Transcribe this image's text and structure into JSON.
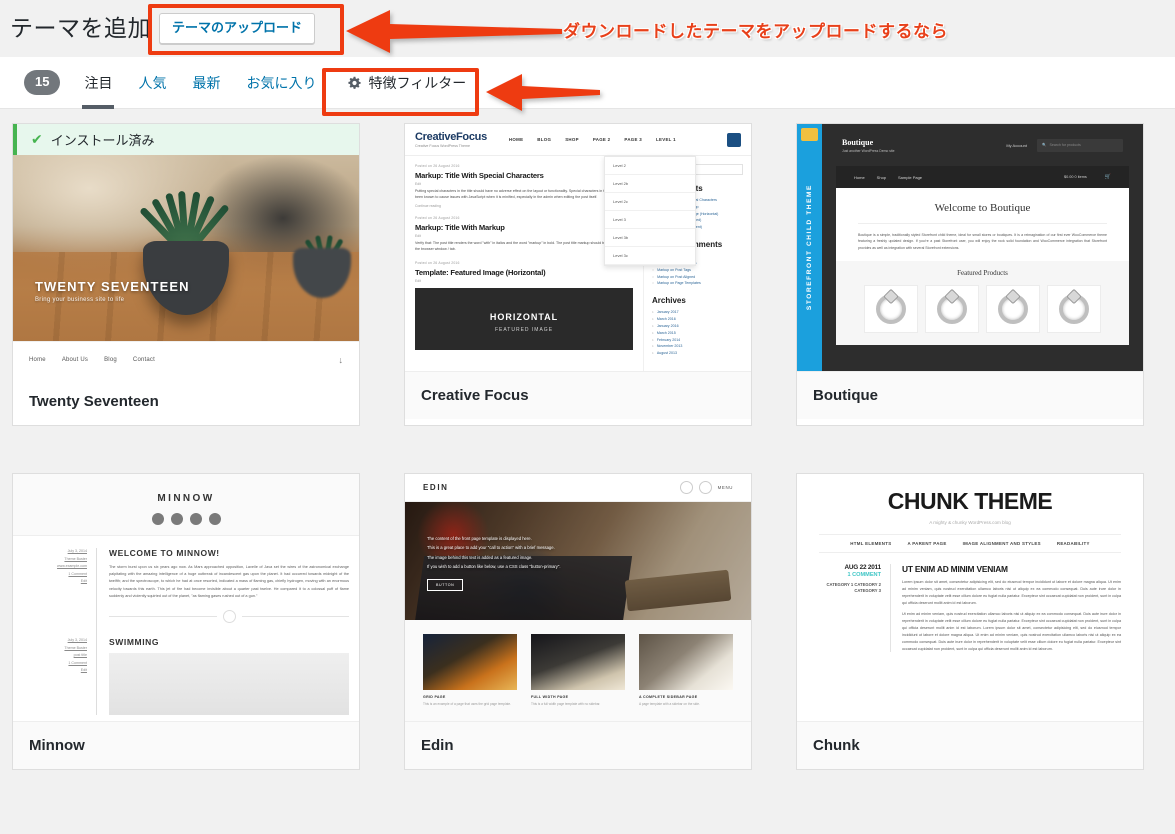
{
  "header": {
    "title": "テーマを追加",
    "upload_button": "テーマのアップロード"
  },
  "tabs": {
    "count_badge": "15",
    "items": [
      {
        "label": "注目",
        "active": true
      },
      {
        "label": "人気",
        "active": false
      },
      {
        "label": "最新",
        "active": false
      },
      {
        "label": "お気に入り",
        "active": false
      }
    ],
    "filter_label": "特徴フィルター",
    "filter_icon": "gear-icon"
  },
  "annotations": {
    "upload_note": "ダウンロードしたテーマをアップロードするなら",
    "accent_color": "#ee3b11"
  },
  "themes": [
    {
      "name": "Twenty Seventeen",
      "installed": true,
      "installed_label": "インストール済み",
      "preview": {
        "hero_title": "TWENTY SEVENTEEN",
        "hero_subtitle": "Bring your business site to life",
        "nav": [
          "Home",
          "About Us",
          "Blog",
          "Contact"
        ],
        "scroll_icon": "↓"
      }
    },
    {
      "name": "Creative Focus",
      "installed": false,
      "preview": {
        "logo": "CreativeFocus",
        "logo_tagline": "Creative Focus WordPress Theme",
        "menu": [
          "HOME",
          "BLOG",
          "SHOP",
          "PAGE 2",
          "PAGE 3",
          "LEVEL 1"
        ],
        "dropdown": [
          "Level 2",
          "Level 2b",
          "Level 2c",
          "Level 3",
          "Level 3b",
          "Level 3c"
        ],
        "posts": [
          {
            "meta": "Posted on 26 August 2016",
            "title": "Markup: Title With Special Characters",
            "sub": "Edit",
            "body": "Putting special characters in the title should have no adverse effect on the layout or functionality. Special characters in the post title have been known to cause issues with JavaScript when it is minified, especially in the admin when editing the post itself.",
            "more": "Continue reading"
          },
          {
            "meta": "Posted on 26 August 2016",
            "title": "Markup: Title With Markup",
            "sub": "Edit",
            "body": "Verify that: The post title renders the word \"with\" in italics and the word \"markup\" in bold. The post title markup should be removed from the browser window / tab."
          },
          {
            "meta": "Posted on 26 August 2016",
            "title": "Template: Featured Image (Horizontal)",
            "sub": "Edit",
            "image_caption_top": "HORIZONTAL",
            "image_caption_bottom": "FEATURED IMAGE"
          }
        ],
        "search_placeholder": "Search …",
        "widgets": [
          {
            "title": "Recent Posts",
            "items": [
              "Markup: Title With Special Characters",
              "Markup: Title With Markup",
              "Template: Featured Image (Horizontal)",
              "Template: Excerpt (Defined)",
              "Template: Sticky (Comment)"
            ]
          },
          {
            "title": "Recent Comments",
            "items": [
              "Markup on Edge Case",
              "Markup on Post Formats",
              "Markup on Post Tags",
              "Markup on Post Aligned",
              "Markup on Page Templates"
            ]
          },
          {
            "title": "Archives",
            "items": [
              "January 2017",
              "March 2016",
              "January 2016",
              "March 2015",
              "February 2014",
              "November 2013",
              "August 2013"
            ]
          }
        ]
      }
    },
    {
      "name": "Boutique",
      "installed": false,
      "preview": {
        "ribbon": "STOREFRONT CHILD THEME",
        "logo": "Boutique",
        "logo_tagline": "Just another WordPress Demo site",
        "account_link": "My Account",
        "search_placeholder": "Search for products",
        "nav": [
          "Home",
          "Shop",
          "Sample Page"
        ],
        "cart": "$0.00 0 items",
        "welcome_title": "Welcome to Boutique",
        "welcome_text": "Boutique is a simple, traditionally styled Storefront child theme, ideal for small stores or boutiques. It is a reimagination of our first ever WooCommerce theme featuring a freshly updated design. If you're a past Storefront user, you will enjoy the rock solid foundation and WooCommerce integration that Storefront provides as well as integration with several Storefront extensions.",
        "featured_title": "Featured Products",
        "product_count": 4
      }
    },
    {
      "name": "Minnow",
      "installed": false,
      "preview": {
        "site_title": "MINNOW",
        "social_icons": [
          "twitter-icon",
          "facebook-icon",
          "google-plus-icon",
          "pinterest-icon"
        ],
        "posts": [
          {
            "title": "WELCOME TO MINNOW!",
            "meta": [
              "July 3, 2014",
              "Theme Buster",
              "www.example.com",
              "1 Comment",
              "Edit"
            ],
            "body": "The storm burst upon us six years ago now. As Mars approached opposition, Lavelle of Java set the wires of the astronomical exchange palpitating with the amazing intelligence of a huge outbreak of incandescent gas upon the planet. It had occurred towards midnight of the twelfth; and the spectroscope, to which he had at once resorted, indicated a mass of flaming gas, chiefly hydrogen, moving with an enormous velocity towards this earth. This jet of fire had become invisible about a quarter past twelve. He compared it to a colossal puff of flame suddenly and violently squirted out of the planet, \"as flaming gases rushed out of a gun.\""
          },
          {
            "title": "SWIMMING",
            "meta": [
              "July 3, 2014",
              "Theme Buster",
              "post title",
              "1 Comment",
              "Edit"
            ]
          }
        ]
      }
    },
    {
      "name": "Edin",
      "installed": false,
      "preview": {
        "site_title": "EDIN",
        "menu_label": "MENU",
        "hero_lines": [
          "The content of the front page template is displayed here.",
          "This is a great place to add your \"call to action\" with a brief message.",
          "The image behind this text is added as a featured image.",
          "If you wish to add a button like below, use a CSS class \"button-primary\"."
        ],
        "hero_button": "BUTTON",
        "cells": [
          {
            "caption": "GRID PAGE",
            "text": "This is an example of a page that uses the grid page template."
          },
          {
            "caption": "FULL WIDTH PAGE",
            "text": "This is a full width page template with no sidebar."
          },
          {
            "caption": "A COMPLETE SIDEBAR PAGE",
            "text": "A page template with a sidebar on the side."
          }
        ]
      }
    },
    {
      "name": "Chunk",
      "installed": false,
      "preview": {
        "site_title": "CHUNK THEME",
        "tagline": "A mighty & chunky WordPress.com blog",
        "nav": [
          "HTML ELEMENTS",
          "A PARENT PAGE",
          "IMAGE ALIGNMENT AND STYLES",
          "READABILITY"
        ],
        "post": {
          "date": "AUG 22 2011",
          "comments": "1 COMMENT",
          "categories": "CATEGORY 1 CATEGORY 2 CATEGORY 3",
          "title": "UT ENIM AD MINIM VENIAM",
          "paragraphs": [
            "Lorem ipsum dolor sit amet, consectetur adipisicing elit, sed do eiusmod tempor incididunt ut labore et dolore magna aliqua. Ut enim ad minim veniam, quis nostrud exercitation ullamco laboris nisi ut aliquip ex ea commodo consequat. Duis aute irure dolor in reprehenderit in voluptate velit esse cillum dolore eu fugiat nulla pariatur. Excepteur sint occaecat cupidatat non proident, sunt in culpa qui officia deserunt mollit anim id est laborum.",
            "Ut enim ad minim veniam, quis nostrud exercitation ullamco laboris nisi ut aliquip ex ea commodo consequat. Duis aute irure dolor in reprehenderit in voluptate velit esse cillum dolore eu fugiat nulla pariatur. Excepteur sint occaecat cupidatat non proident, sunt in culpa qui officia deserunt mollit anim id est laborum. Lorem ipsum dolor sit amet, consectetur adipisicing elit, sed do eiusmod tempor incididunt ut labore et dolore magna aliqua. Ut enim ad minim veniam, quis nostrud exercitation ullamco laboris nisi ut aliquip ex ea commodo consequat. Duis aute irure dolor in reprehenderit in voluptate velit esse cillum dolore eu fugiat nulla pariatur. Excepteur sint occaecat cupidatat non proident, sunt in culpa qui officia deserunt mollit anim id est laborum."
          ]
        }
      }
    }
  ]
}
